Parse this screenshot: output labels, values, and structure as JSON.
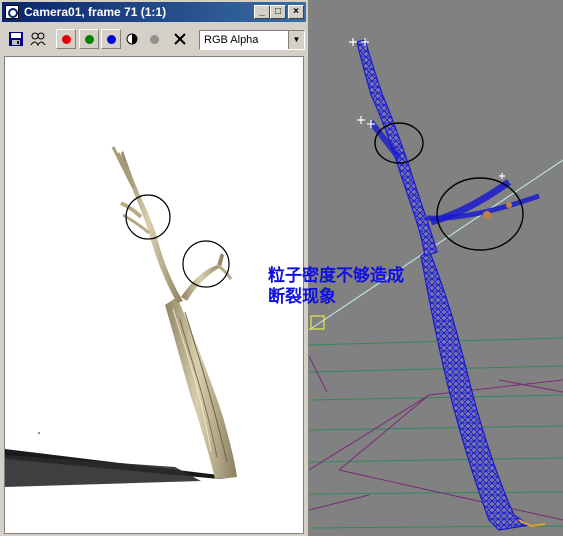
{
  "window": {
    "title": "Camera01, frame 71 (1:1)",
    "buttons": {
      "minimize": "_",
      "maximize": "□",
      "close": "×"
    }
  },
  "toolbar": {
    "tools": [
      "save-icon",
      "clone-icon",
      "red-channel-icon",
      "green-channel-icon",
      "blue-channel-icon",
      "mono-icon",
      "alpha-icon",
      "clear-icon"
    ],
    "channel_select": {
      "value": "RGB Alpha"
    },
    "colors": {
      "red": "#e00000",
      "green": "#008000",
      "blue": "#0000e0"
    }
  },
  "annotation": {
    "line1": "粒子密度不够造成",
    "line2": "断裂现象",
    "color": "#1010e0"
  },
  "colors": {
    "circle_marks": "#000000",
    "wireframe": "#1a1ad0",
    "viewport_bg": "#818181",
    "branch": "#b8ab86"
  }
}
